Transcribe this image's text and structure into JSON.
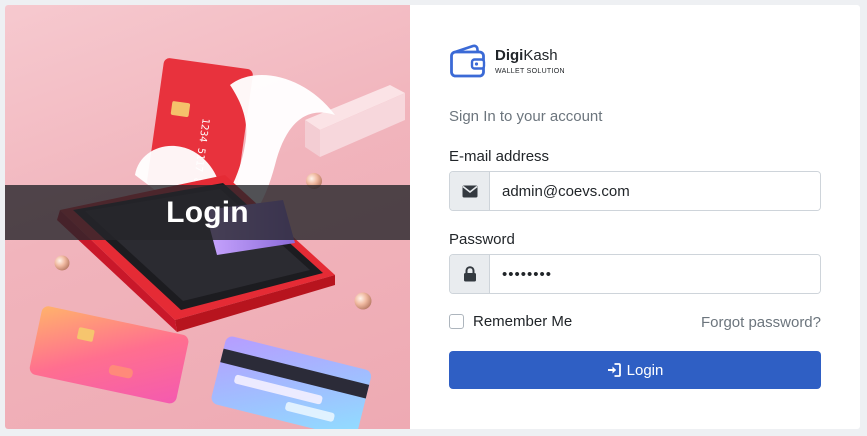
{
  "hero": {
    "overlay_title": "Login",
    "card_number_partial": "1234 5117 8"
  },
  "brand": {
    "name_bold": "Digi",
    "name_rest": "Kash",
    "tagline": "WALLET SOLUTION",
    "icon": "wallet-icon",
    "color": "#3b6ad6"
  },
  "form": {
    "subtitle": "Sign In to your account",
    "email": {
      "label": "E-mail address",
      "value": "admin@coevs.com",
      "icon": "envelope-icon"
    },
    "password": {
      "label": "Password",
      "value": "••••••••",
      "icon": "lock-icon"
    },
    "remember_label": "Remember Me",
    "remember_checked": false,
    "forgot_label": "Forgot password?",
    "submit_label": "Login",
    "submit_icon": "sign-in-icon"
  },
  "colors": {
    "primary": "#2f5fc4",
    "hero_bg": "#f1b4bc",
    "muted_text": "#6c757d"
  }
}
